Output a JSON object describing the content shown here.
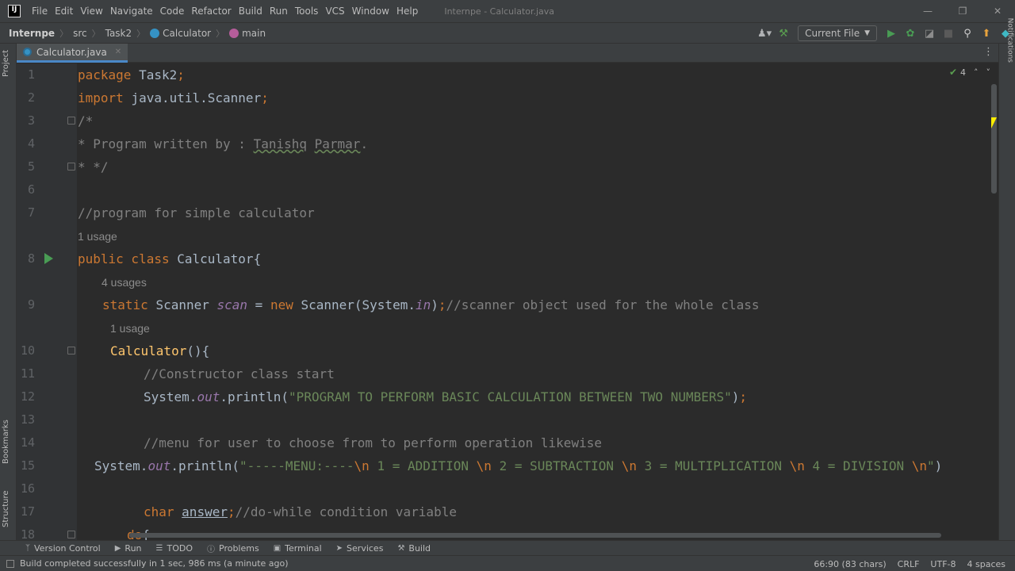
{
  "app": {
    "logo": "IJ",
    "window_title": "Internpe - Calculator.java",
    "menu": [
      "File",
      "Edit",
      "View",
      "Navigate",
      "Code",
      "Refactor",
      "Build",
      "Run",
      "Tools",
      "VCS",
      "Window",
      "Help"
    ]
  },
  "breadcrumbs": [
    "Internpe",
    "src",
    "Task2",
    "Calculator",
    "main"
  ],
  "run_config": "Current File",
  "tab": {
    "label": "Calculator.java"
  },
  "left_tools": {
    "project": "Project",
    "bookmarks": "Bookmarks",
    "structure": "Structure"
  },
  "right_tools": {
    "notifications": "Notifications"
  },
  "inspection": {
    "count": "4"
  },
  "code_lines": [
    {
      "n": "1",
      "parts": [
        [
          "kw",
          "package "
        ],
        [
          "p",
          "Task2"
        ],
        [
          "kw",
          ";"
        ]
      ]
    },
    {
      "n": "2",
      "parts": [
        [
          "kw",
          "import "
        ],
        [
          "p",
          "java.util.Scanner"
        ],
        [
          "kw",
          ";"
        ]
      ]
    },
    {
      "n": "3",
      "parts": [
        [
          "cm",
          "/*"
        ]
      ]
    },
    {
      "n": "4",
      "parts": [
        [
          "cm",
          "* Program written by : "
        ],
        [
          "cmu",
          "Tanishq"
        ],
        [
          "cm",
          " "
        ],
        [
          "cmu",
          "Parmar"
        ],
        [
          "cm",
          "."
        ]
      ]
    },
    {
      "n": "5",
      "parts": [
        [
          "cm",
          "* */"
        ]
      ]
    },
    {
      "n": "6",
      "parts": []
    },
    {
      "n": "7",
      "parts": [
        [
          "cm",
          "//program for simple calculator"
        ]
      ]
    },
    {
      "n": "8",
      "parts": [
        [
          "kw",
          "public class "
        ],
        [
          "p",
          "Calculator{"
        ]
      ]
    },
    {
      "n": "9",
      "parts": [
        [
          "kw",
          "static "
        ],
        [
          "p",
          "Scanner "
        ],
        [
          "fld",
          "scan"
        ],
        [
          "p",
          " = "
        ],
        [
          "kw",
          "new "
        ],
        [
          "p",
          "Scanner(System."
        ],
        [
          "fld",
          "in"
        ],
        [
          "p",
          ")"
        ],
        [
          "kw",
          ";"
        ],
        [
          "cm",
          "//scanner object used for the whole class"
        ]
      ]
    },
    {
      "n": "10",
      "parts": [
        [
          "ctor",
          "Calculator"
        ],
        [
          "p",
          "(){"
        ]
      ]
    },
    {
      "n": "11",
      "parts": [
        [
          "cm",
          "//Constructor class start"
        ]
      ]
    },
    {
      "n": "12",
      "parts": [
        [
          "p",
          "System."
        ],
        [
          "fld",
          "out"
        ],
        [
          "p",
          ".println("
        ],
        [
          "str",
          "\"PROGRAM TO PERFORM BASIC CALCULATION BETWEEN TWO NUMBERS\""
        ],
        [
          "p",
          ")"
        ],
        [
          "kw",
          ";"
        ]
      ]
    },
    {
      "n": "13",
      "parts": []
    },
    {
      "n": "14",
      "parts": [
        [
          "cm",
          "//menu for user to choose from to perform operation likewise"
        ]
      ]
    },
    {
      "n": "15",
      "parts": [
        [
          "p",
          "System."
        ],
        [
          "fld",
          "out"
        ],
        [
          "p",
          ".println("
        ],
        [
          "str",
          "\"-----MENU:----"
        ],
        [
          "esc",
          "\\n"
        ],
        [
          "str",
          " 1 = ADDITION "
        ],
        [
          "esc",
          "\\n"
        ],
        [
          "str",
          " 2 = SUBTRACTION "
        ],
        [
          "esc",
          "\\n"
        ],
        [
          "str",
          " 3 = MULTIPLICATION "
        ],
        [
          "esc",
          "\\n"
        ],
        [
          "str",
          " 4 = DIVISION "
        ],
        [
          "esc",
          "\\n"
        ],
        [
          "str",
          "\""
        ],
        [
          "p",
          ")"
        ]
      ]
    },
    {
      "n": "16",
      "parts": []
    },
    {
      "n": "17",
      "parts": [
        [
          "kw",
          "char "
        ],
        [
          "pu",
          "answer"
        ],
        [
          "kw",
          ";"
        ],
        [
          "cm",
          "//do-while condition variable"
        ]
      ]
    },
    {
      "n": "18",
      "parts": [
        [
          "kw",
          "do"
        ],
        [
          "p",
          "{"
        ]
      ]
    }
  ],
  "hints": {
    "h1": "1 usage",
    "h2": "4 usages",
    "h3": "1 usage"
  },
  "bottom_tools": [
    "Version Control",
    "Run",
    "TODO",
    "Problems",
    "Terminal",
    "Services",
    "Build"
  ],
  "status": {
    "message": "Build completed successfully in 1 sec, 986 ms (a minute ago)",
    "position": "66:90 (83 chars)",
    "line_sep": "CRLF",
    "encoding": "UTF-8",
    "indent": "4 spaces"
  }
}
